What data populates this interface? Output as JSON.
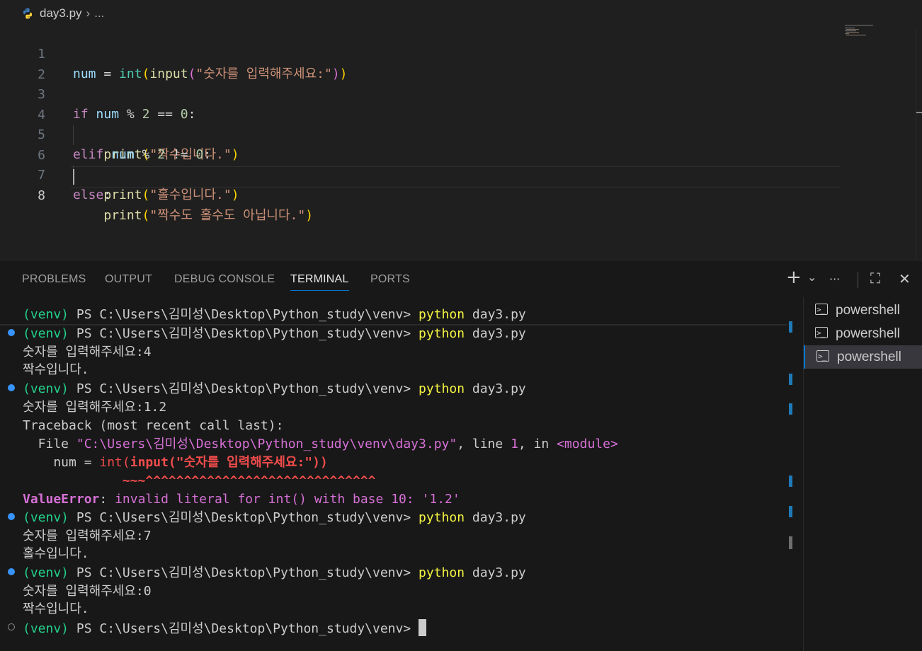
{
  "breadcrumb": {
    "file": "day3.py",
    "more": "..."
  },
  "editor": {
    "lines": [
      {
        "n": "1",
        "code": "num = int(input(\"숫자를 입력해주세요:\"))"
      },
      {
        "n": "2",
        "code": ""
      },
      {
        "n": "3",
        "code": "if num % 2 == 0:"
      },
      {
        "n": "4",
        "code": "    print(\"짝수입니다.\")"
      },
      {
        "n": "5",
        "code": "elif num % 2 != 0:"
      },
      {
        "n": "6",
        "code": "    print(\"홀수입니다.\")"
      },
      {
        "n": "7",
        "code": "else:"
      },
      {
        "n": "8",
        "code": "    print(\"짝수도 홀수도 아닙니다.\")"
      }
    ],
    "active_line": "8"
  },
  "panel": {
    "tabs": [
      "PROBLEMS",
      "OUTPUT",
      "DEBUG CONSOLE",
      "TERMINAL",
      "PORTS"
    ],
    "active_tab": "TERMINAL",
    "tools": {
      "add": "+",
      "chevron": "⌄",
      "more": "···",
      "maximize": "⛶",
      "close": "✕"
    }
  },
  "terminal": {
    "venv": "(venv)",
    "prompt": " PS C:\\Users\\김미성\\Desktop\\Python_study\\venv> ",
    "cmd1": "python",
    "cmd2": " day3.py",
    "input_prompt": "숫자를 입력해주세요:",
    "in1": "4",
    "out1": "짝수입니다.",
    "in2": "1.2",
    "traceback": "Traceback (most recent call last):",
    "file_kw": "  File ",
    "file_path": "\"C:\\Users\\김미성\\Desktop\\Python_study\\venv\\day3.py\"",
    "line_kw": ", line ",
    "line_no": "1",
    "in_kw": ", in ",
    "module": "<module>",
    "src_pre": "    num = ",
    "src_int": "int(",
    "src_rest": "input(\"숫자를 입력해주세요:\"))",
    "carets": "             ~~~^^^^^^^^^^^^^^^^^^^^^^^^^^^^^^",
    "err_name": "ValueError",
    "err_colon": ": ",
    "err_msg": "invalid literal for int() with base 10: '1.2'",
    "in3": "7",
    "out3": "홀수입니다.",
    "in4": "0",
    "out4": "짝수입니다."
  },
  "terminal_list": {
    "items": [
      "powershell",
      "powershell",
      "powershell"
    ],
    "selected_index": 2
  },
  "colors": {
    "accent": "#0078d4",
    "venv_green": "#23d18b",
    "command_yellow": "#f5f543",
    "error_red": "#f14c4c",
    "path_magenta": "#d670d6"
  }
}
